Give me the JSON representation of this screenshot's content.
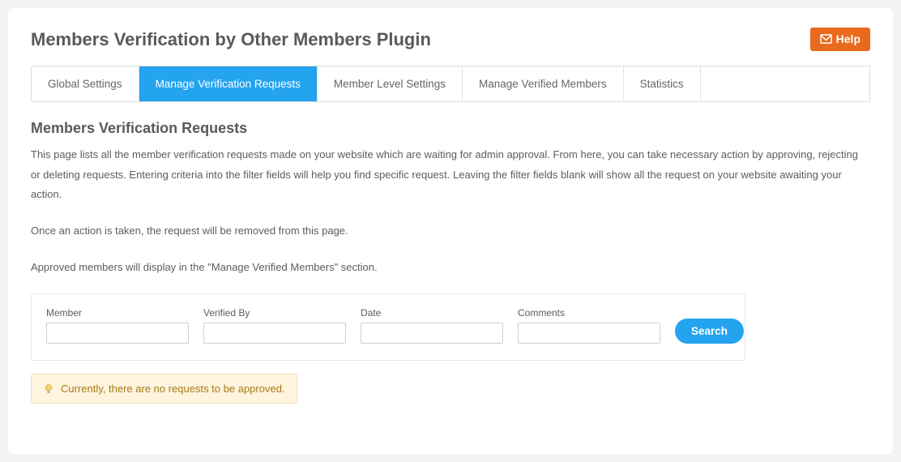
{
  "header": {
    "title": "Members Verification by Other Members Plugin",
    "help_label": "Help"
  },
  "tabs": [
    {
      "label": "Global Settings",
      "active": false
    },
    {
      "label": "Manage Verification Requests",
      "active": true
    },
    {
      "label": "Member Level Settings",
      "active": false
    },
    {
      "label": "Manage Verified Members",
      "active": false
    },
    {
      "label": "Statistics",
      "active": false
    }
  ],
  "section": {
    "title": "Members Verification Requests",
    "para1": "This page lists all the member verification requests made on your website which are waiting for admin approval. From here, you can take necessary action by approving, rejecting or deleting requests. Entering criteria into the filter fields will help you find specific request. Leaving the filter fields blank will show all the request on your website awaiting your action.",
    "para2": "Once an action is taken, the request will be removed from this page.",
    "para3": "Approved members will display in the \"Manage Verified Members\" section."
  },
  "filters": {
    "member_label": "Member",
    "member_value": "",
    "verified_by_label": "Verified By",
    "verified_by_value": "",
    "date_label": "Date",
    "date_value": "",
    "comments_label": "Comments",
    "comments_value": "",
    "search_label": "Search"
  },
  "tip": {
    "text": "Currently, there are no requests to be approved."
  }
}
